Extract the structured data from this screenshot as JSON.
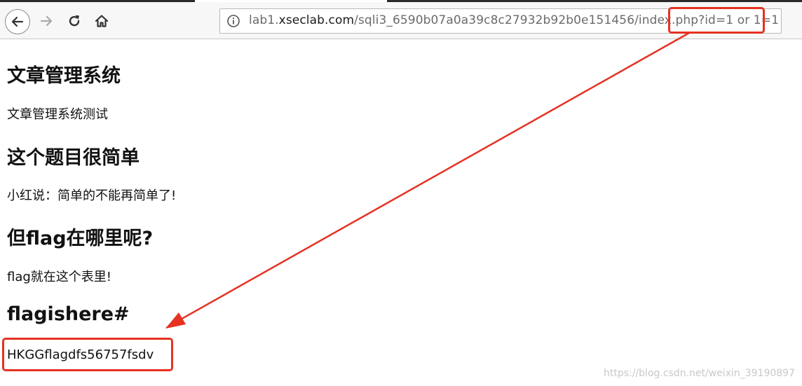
{
  "browser": {
    "icons": {
      "back": "back-arrow-icon",
      "forward": "forward-arrow-icon",
      "reload": "reload-icon",
      "home": "home-icon",
      "info": "info-icon"
    },
    "url_prefix": "lab1.",
    "url_host": "xseclab.com",
    "url_path": "/sqli3_6590b07a0a39c8c27932b92b0e151456/index.php",
    "url_query": "?id=1 or 1=1"
  },
  "page": {
    "heading1": "文章管理系统",
    "text1": "文章管理系统测试",
    "heading2": "这个题目很简单",
    "text2": "小红说：简单的不能再简单了!",
    "heading3": "但flag在哪里呢?",
    "text3": "flag就在这个表里!",
    "heading4": "flagishere#",
    "flag_value": "HKGGflagdfs56757fsdv"
  },
  "annotation": {
    "highlight_color": "#e53222"
  },
  "watermark": "https://blog.csdn.net/weixin_39190897"
}
